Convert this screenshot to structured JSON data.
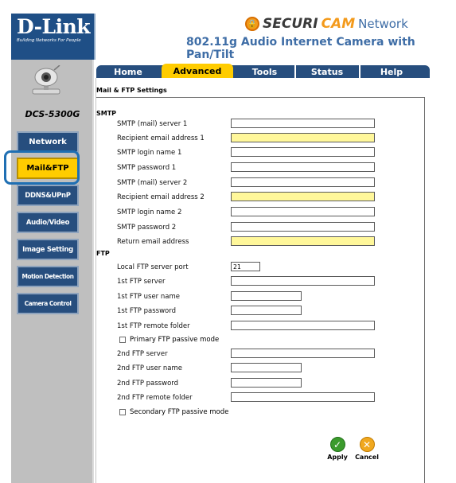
{
  "header": {
    "logo": "D-Link",
    "tagline": "Building Networks For People",
    "brand_securi": "SECURI",
    "brand_cam": "CAM",
    "brand_network": "Network",
    "product": "802.11g Audio Internet Camera with Pan/Tilt"
  },
  "sidebar": {
    "model": "DCS-5300G",
    "items": [
      {
        "label": "Network",
        "active": false
      },
      {
        "label": "Mail&FTP",
        "active": true
      },
      {
        "label": "DDNS&UPnP",
        "active": false
      },
      {
        "label": "Audio/Video",
        "active": false
      },
      {
        "label": "Image Setting",
        "active": false
      },
      {
        "label": "Motion Detection",
        "active": false
      },
      {
        "label": "Camera Control",
        "active": false
      }
    ]
  },
  "tabs": [
    {
      "label": "Home",
      "active": false
    },
    {
      "label": "Advanced",
      "active": true
    },
    {
      "label": "Tools",
      "active": false
    },
    {
      "label": "Status",
      "active": false
    },
    {
      "label": "Help",
      "active": false
    }
  ],
  "content": {
    "title": "Mail & FTP Settings",
    "smtp": {
      "heading": "SMTP",
      "fields": [
        {
          "label": "SMTP (mail) server 1",
          "value": "",
          "highlight": false
        },
        {
          "label": "Recipient email address 1",
          "value": "",
          "highlight": true
        },
        {
          "label": "SMTP login name 1",
          "value": "",
          "highlight": false
        },
        {
          "label": "SMTP password 1",
          "value": "",
          "highlight": false
        },
        {
          "label": "SMTP (mail) server 2",
          "value": "",
          "highlight": false
        },
        {
          "label": "Recipient email address 2",
          "value": "",
          "highlight": true
        },
        {
          "label": "SMTP login name 2",
          "value": "",
          "highlight": false
        },
        {
          "label": "SMTP password 2",
          "value": "",
          "highlight": false
        },
        {
          "label": "Return email address",
          "value": "",
          "highlight": true
        }
      ]
    },
    "ftp": {
      "heading": "FTP",
      "port_label": "Local FTP server port",
      "port_value": "21",
      "primary": {
        "server_label": "1st FTP server",
        "server_value": "",
        "user_label": "1st FTP user name",
        "user_value": "",
        "password_label": "1st FTP password",
        "password_value": "",
        "folder_label": "1st FTP remote folder",
        "folder_value": "",
        "passive_label": "Primary FTP passive mode",
        "passive_checked": false
      },
      "secondary": {
        "server_label": "2nd FTP server",
        "server_value": "",
        "user_label": "2nd FTP user name",
        "user_value": "",
        "password_label": "2nd FTP password",
        "password_value": "",
        "folder_label": "2nd FTP remote folder",
        "folder_value": "",
        "passive_label": "Secondary FTP passive mode",
        "passive_checked": false
      }
    },
    "actions": {
      "apply": "Apply",
      "cancel": "Cancel"
    }
  },
  "colors": {
    "nav_blue": "#274e7e",
    "active_yellow": "#ffcc00",
    "required_field": "#fff79a",
    "apply_green": "#3b9b2c",
    "cancel_orange": "#f0a81f"
  }
}
